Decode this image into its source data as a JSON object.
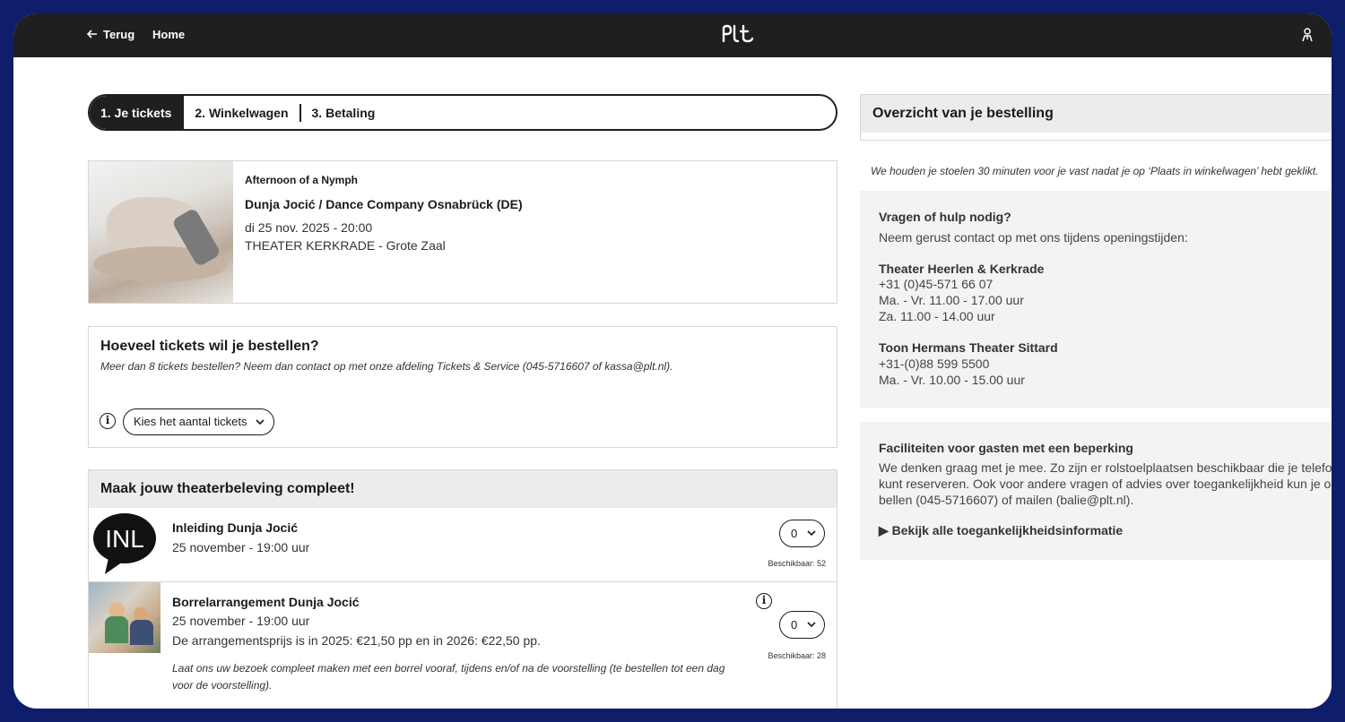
{
  "topbar": {
    "back_label": "Terug",
    "home_label": "Home",
    "logo": "PLt"
  },
  "steps": [
    {
      "label": "1. Je tickets",
      "active": true
    },
    {
      "label": "2. Winkelwagen",
      "active": false
    },
    {
      "label": "3. Betaling",
      "active": false
    }
  ],
  "event": {
    "name": "Afternoon of a Nymph",
    "company": "Dunja Jocić / Dance Company Osnabrück (DE)",
    "date": "di 25 nov. 2025 - 20:00",
    "venue": "THEATER KERKRADE - Grote Zaal"
  },
  "quantity": {
    "title": "Hoeveel tickets wil je bestellen?",
    "note": "Meer dan 8 tickets bestellen? Neem dan contact op met onze afdeling Tickets & Service (045-5716607 of kassa@plt.nl).",
    "select_label": "Kies het aantal tickets"
  },
  "extras": {
    "title": "Maak jouw theaterbeleving compleet!",
    "items": [
      {
        "icon_text": "INL",
        "title": "Inleiding Dunja Jocić",
        "date": "25 november - 19:00 uur",
        "qty": "0",
        "available": "Beschikbaar: 52"
      },
      {
        "title": "Borrelarrangement Dunja Jocić",
        "date": "25 november - 19:00 uur",
        "price": "De arrangementsprijs is in 2025: €21,50 pp en in 2026: €22,50 pp.",
        "description": "Laat ons uw bezoek compleet maken met een borrel vooraf, tijdens en/of na de voorstelling (te bestellen tot een dag voor de voorstelling).",
        "qty": "0",
        "available": "Beschikbaar: 28"
      }
    ]
  },
  "overview": {
    "title": "Overzicht van je bestelling",
    "hold_note": "We houden je stoelen 30 minuten voor je vast nadat je op ‘Plaats in winkelwagen’ hebt geklikt."
  },
  "help": {
    "title": "Vragen of hulp nodig?",
    "intro": "Neem gerust contact op met ons tijdens openingstijden:",
    "venues": [
      {
        "name": "Theater Heerlen & Kerkrade",
        "phone": "+31 (0)45-571 66 07",
        "hours1": "Ma. - Vr. 11.00 - 17.00 uur",
        "hours2": "Za. 11.00 - 14.00 uur"
      },
      {
        "name": "Toon Hermans Theater Sittard",
        "phone": "+31-(0)88 599 5500",
        "hours1": "Ma. - Vr. 10.00 - 15.00 uur"
      }
    ]
  },
  "facilities": {
    "title": "Faciliteiten voor gasten met een beperking",
    "line1": "We denken graag met je mee. Zo zijn er rolstoelplaatsen beschikbaar die je telefonisch",
    "line2": "kunt reserveren. Ook voor andere vragen of advies over toegankelijkheid kun je ons",
    "line3": "bellen (045-5716607) of mailen (balie@plt.nl).",
    "link": "▶ Bekijk alle toegankelijkheidsinformatie"
  }
}
